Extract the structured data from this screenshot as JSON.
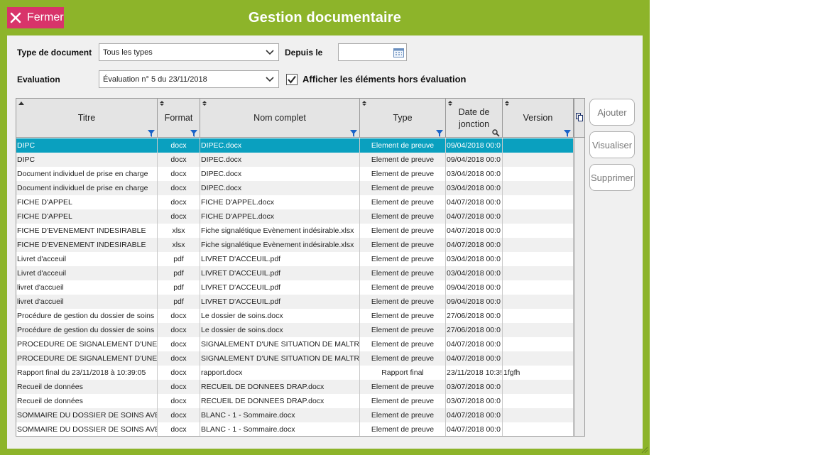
{
  "window": {
    "title": "Gestion documentaire",
    "close_label": "Fermer"
  },
  "filters": {
    "type_label": "Type de document",
    "type_value": "Tous les types",
    "since_label": "Depuis le",
    "since_value": "",
    "evaluation_label": "Evaluation",
    "evaluation_value": "Évaluation n° 5 du 23/11/2018",
    "show_outside_label": "Afficher les éléments hors évaluation",
    "show_outside_checked": true
  },
  "grid": {
    "columns": [
      {
        "key": "titre",
        "label": "Titre"
      },
      {
        "key": "format",
        "label": "Format"
      },
      {
        "key": "nom",
        "label": "Nom complet"
      },
      {
        "key": "type",
        "label": "Type"
      },
      {
        "key": "date",
        "label": "Date de jonction"
      },
      {
        "key": "version",
        "label": "Version"
      }
    ],
    "rows": [
      {
        "titre": "DIPC",
        "format": "docx",
        "nom": "DIPEC.docx",
        "type": "Element de preuve",
        "date": "09/04/2018 00:0",
        "version": ""
      },
      {
        "titre": "DIPC",
        "format": "docx",
        "nom": "DIPEC.docx",
        "type": "Element de preuve",
        "date": "09/04/2018 00:0",
        "version": ""
      },
      {
        "titre": "Document individuel de prise en charge",
        "format": "docx",
        "nom": "DIPEC.docx",
        "type": "Element de preuve",
        "date": "03/04/2018 00:0",
        "version": ""
      },
      {
        "titre": "Document individuel de prise en charge",
        "format": "docx",
        "nom": "DIPEC.docx",
        "type": "Element de preuve",
        "date": "03/04/2018 00:0",
        "version": ""
      },
      {
        "titre": "FICHE D'APPEL",
        "format": "docx",
        "nom": "FICHE D'APPEL.docx",
        "type": "Element de preuve",
        "date": "04/07/2018 00:0",
        "version": ""
      },
      {
        "titre": "FICHE D'APPEL",
        "format": "docx",
        "nom": "FICHE D'APPEL.docx",
        "type": "Element de preuve",
        "date": "04/07/2018 00:0",
        "version": ""
      },
      {
        "titre": "FICHE D'EVENEMENT INDESIRABLE",
        "format": "xlsx",
        "nom": "Fiche signalétique Evènement indésirable.xlsx",
        "type": "Element de preuve",
        "date": "04/07/2018 00:0",
        "version": ""
      },
      {
        "titre": "FICHE D'EVENEMENT INDESIRABLE",
        "format": "xlsx",
        "nom": "Fiche signalétique Evènement indésirable.xlsx",
        "type": "Element de preuve",
        "date": "04/07/2018 00:0",
        "version": ""
      },
      {
        "titre": "Livret d'acceuil",
        "format": "pdf",
        "nom": "LIVRET D'ACCEUIL.pdf",
        "type": "Element de preuve",
        "date": "03/04/2018 00:0",
        "version": ""
      },
      {
        "titre": "Livret d'acceuil",
        "format": "pdf",
        "nom": "LIVRET D'ACCEUIL.pdf",
        "type": "Element de preuve",
        "date": "03/04/2018 00:0",
        "version": ""
      },
      {
        "titre": "livret d'accueil",
        "format": "pdf",
        "nom": "LIVRET D'ACCEUIL.pdf",
        "type": "Element de preuve",
        "date": "09/04/2018 00:0",
        "version": ""
      },
      {
        "titre": "livret d'accueil",
        "format": "pdf",
        "nom": "LIVRET D'ACCEUIL.pdf",
        "type": "Element de preuve",
        "date": "09/04/2018 00:0",
        "version": ""
      },
      {
        "titre": "Procédure de gestion du dossier de soins",
        "format": "docx",
        "nom": "Le dossier de soins.docx",
        "type": "Element de preuve",
        "date": "27/06/2018 00:0",
        "version": ""
      },
      {
        "titre": "Procédure de gestion du dossier de soins",
        "format": "docx",
        "nom": "Le dossier de soins.docx",
        "type": "Element de preuve",
        "date": "27/06/2018 00:0",
        "version": ""
      },
      {
        "titre": "PROCEDURE DE SIGNALEMENT D'UNE S",
        "format": "docx",
        "nom": "SIGNALEMENT D'UNE SITUATION DE MALTRA",
        "type": "Element de preuve",
        "date": "04/07/2018 00:0",
        "version": ""
      },
      {
        "titre": "PROCEDURE DE SIGNALEMENT D'UNE S",
        "format": "docx",
        "nom": "SIGNALEMENT D'UNE SITUATION DE MALTRA",
        "type": "Element de preuve",
        "date": "04/07/2018 00:0",
        "version": ""
      },
      {
        "titre": "Rapport final du 23/11/2018 à 10:39:05",
        "format": "docx",
        "nom": "rapport.docx",
        "type": "Rapport final",
        "date": "23/11/2018 10:3!",
        "version": "1fgfh"
      },
      {
        "titre": "Recueil de données",
        "format": "docx",
        "nom": "RECUEIL DE DONNEES DRAP.docx",
        "type": "Element de preuve",
        "date": "03/07/2018 00:0",
        "version": ""
      },
      {
        "titre": "Recueil de données",
        "format": "docx",
        "nom": "RECUEIL DE DONNEES DRAP.docx",
        "type": "Element de preuve",
        "date": "03/07/2018 00:0",
        "version": ""
      },
      {
        "titre": "SOMMAIRE DU DOSSIER DE SOINS AVE(",
        "format": "docx",
        "nom": "BLANC - 1 - Sommaire.docx",
        "type": "Element de preuve",
        "date": "04/07/2018 00:0",
        "version": ""
      },
      {
        "titre": "SOMMAIRE DU DOSSIER DE SOINS AVE(",
        "format": "docx",
        "nom": "BLANC - 1 - Sommaire.docx",
        "type": "Element de preuve",
        "date": "04/07/2018 00:0",
        "version": ""
      }
    ],
    "selected_row": 0
  },
  "actions": {
    "add": "Ajouter",
    "view": "Visualiser",
    "delete": "Supprimer"
  },
  "colors": {
    "frame": "#8db42a",
    "close": "#d8346a",
    "selection": "#0aa0bf",
    "panel": "#f0f0f0"
  }
}
